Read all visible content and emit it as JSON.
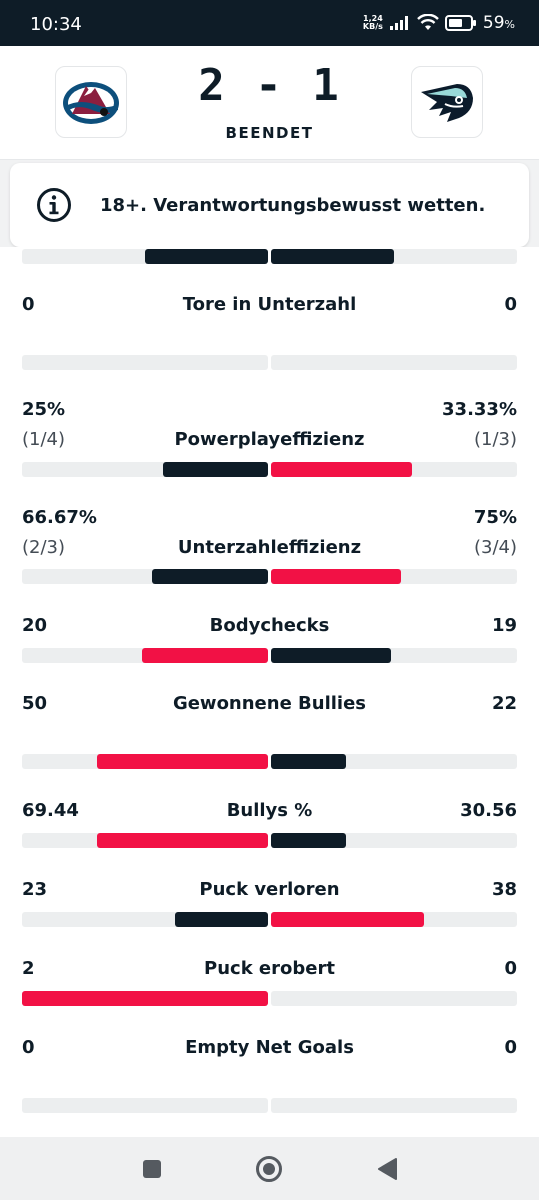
{
  "status_bar": {
    "time": "10:34",
    "net_speed_value": "1,24",
    "net_speed_unit": "KB/s",
    "battery": "59",
    "battery_unit": "%"
  },
  "match": {
    "score": "2 - 1",
    "status": "BEENDET",
    "home_logo": "avalanche-logo-icon",
    "away_logo": "kraken-logo-icon"
  },
  "notice": {
    "icon": "info-icon",
    "text": "18+. Verantwortungsbewusst wetten."
  },
  "colors": {
    "dark": "#0e1c27",
    "accent": "#f21145",
    "track": "#eceeef"
  },
  "stats": [
    {
      "label": "",
      "home": "",
      "away": "",
      "home_bar": 0.5,
      "away_bar": 0.5,
      "home_color": "dark",
      "away_color": "dark"
    },
    {
      "label": "Tore in Unterzahl",
      "home": "0",
      "away": "0",
      "home_bar": 0,
      "away_bar": 0,
      "home_color": "dark",
      "away_color": "dark"
    },
    {
      "label": "Powerplayeffizienz",
      "home": "25%",
      "home_sub": "(1/4)",
      "away": "33.33%",
      "away_sub": "(1/3)",
      "home_bar": 0.4286,
      "away_bar": 0.5714,
      "home_color": "dark",
      "away_color": "accent"
    },
    {
      "label": "Unterzahleffizienz",
      "home": "66.67%",
      "home_sub": "(2/3)",
      "away": "75%",
      "away_sub": "(3/4)",
      "home_bar": 0.4706,
      "away_bar": 0.5294,
      "home_color": "dark",
      "away_color": "accent"
    },
    {
      "label": "Bodychecks",
      "home": "20",
      "away": "19",
      "home_bar": 0.5128,
      "away_bar": 0.4872,
      "home_color": "accent",
      "away_color": "dark"
    },
    {
      "label": "Gewonnene Bullies",
      "home": "50",
      "away": "22",
      "home_bar": 0.6944,
      "away_bar": 0.3056,
      "home_color": "accent",
      "away_color": "dark"
    },
    {
      "label": "Bullys %",
      "home": "69.44",
      "away": "30.56",
      "home_bar": 0.6944,
      "away_bar": 0.3056,
      "home_color": "accent",
      "away_color": "dark"
    },
    {
      "label": "Puck verloren",
      "home": "23",
      "away": "38",
      "home_bar": 0.377,
      "away_bar": 0.623,
      "home_color": "dark",
      "away_color": "accent"
    },
    {
      "label": "Puck erobert",
      "home": "2",
      "away": "0",
      "home_bar": 1.0,
      "away_bar": 0,
      "home_color": "accent",
      "away_color": "dark"
    },
    {
      "label": "Empty Net Goals",
      "home": "0",
      "away": "0",
      "home_bar": 0,
      "away_bar": 0,
      "home_color": "dark",
      "away_color": "dark"
    }
  ],
  "nav": {
    "recents": "square-recents-icon",
    "home": "circle-home-icon",
    "back": "triangle-back-icon"
  }
}
